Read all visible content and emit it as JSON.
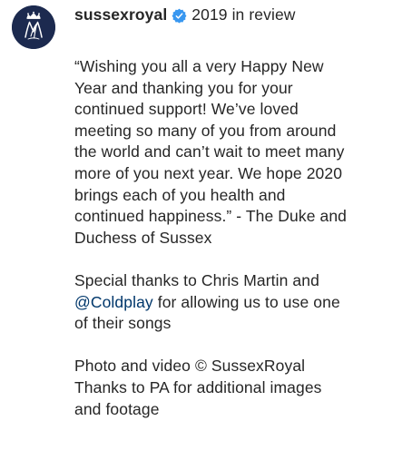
{
  "post": {
    "username": "sussexroyal",
    "verified_icon": "verified-badge-icon",
    "avatar_icon": "crest-monogram-icon",
    "brand_color": "#1c2a4f",
    "verified_color": "#3897f0",
    "mention_color": "#00376b",
    "header_text": "2019 in review",
    "quote_lines": [
      "“Wishing you all a very Happy New",
      "Year and thanking you for your",
      "continued support! We’ve loved",
      "meeting so many of you from around",
      "the world and can’t wait to meet many",
      "more of you next year. We hope 2020",
      "brings each of you health and",
      "continued happiness.” - The Duke and",
      "Duchess of Sussex"
    ],
    "thanks": {
      "line1": "Special thanks to Chris Martin and",
      "mention": "@Coldplay",
      "line2_rest": " for allowing us to use one",
      "line3": "of their songs"
    },
    "credit_lines": [
      "Photo and video © SussexRoyal",
      "Thanks to PA for additional images",
      "and footage"
    ]
  }
}
